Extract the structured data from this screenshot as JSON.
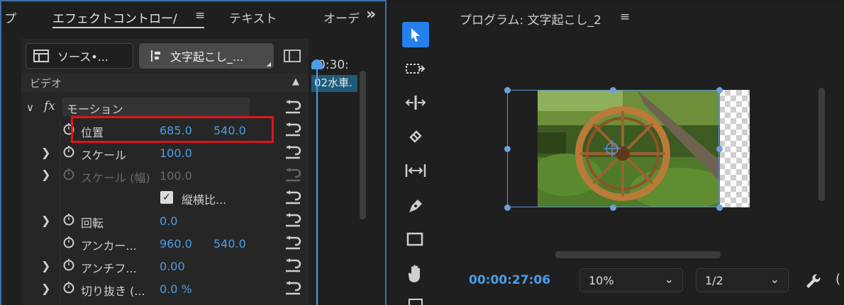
{
  "effect_controls": {
    "tabs": {
      "partial_left": "プ",
      "effect_controls": "エフェクトコントロー/",
      "menu": "≡",
      "text": "テキスト",
      "audio_partial": "オーデ",
      "more": "»"
    },
    "source_button": "ソース•...",
    "sequence_button": "文字起こし_...",
    "video_header": "ビデオ",
    "fx_label": "fx",
    "motion_label": "モーション",
    "rows": {
      "position": {
        "label": "位置",
        "x": "685.0",
        "y": "540.0"
      },
      "scale": {
        "label": "スケール",
        "value": "100.0"
      },
      "scale_width": {
        "label": "スケール (幅)",
        "value": "100.0"
      },
      "uniform_scale": {
        "label": "縦横比...",
        "checked": true
      },
      "rotation": {
        "label": "回転",
        "value": "0.0"
      },
      "anchor": {
        "label": "アンカー...",
        "x": "960.0",
        "y": "540.0"
      },
      "antiflicker": {
        "label": "アンチフ...",
        "value": "0.00"
      },
      "crop": {
        "label": "切り抜き (...",
        "value": "0.0 %"
      }
    },
    "timeline": {
      "timecode": "0:30:",
      "clip_label": "02水車."
    }
  },
  "program_monitor": {
    "title": "プログラム: 文字起こし_2",
    "menu": "≡",
    "timecode": "00:00:27:06",
    "zoom": "10%",
    "resolution": "1/2"
  },
  "tools": [
    "selection-tool",
    "track-select-tool",
    "ripple-edit-tool",
    "razor-tool",
    "slip-tool",
    "pen-tool",
    "rectangle-tool",
    "hand-tool"
  ],
  "colors": {
    "accent": "#4c9ee9",
    "highlight_box": "#e0141b",
    "selected_tool": "#2680eb"
  }
}
